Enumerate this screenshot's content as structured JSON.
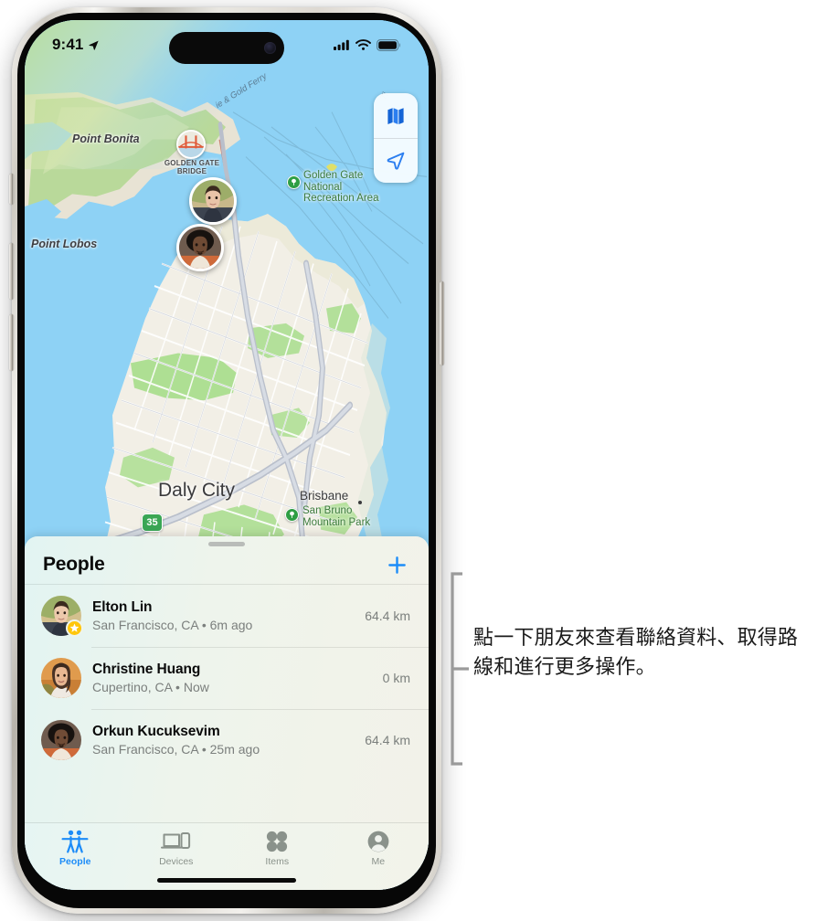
{
  "status_bar": {
    "time": "9:41",
    "location_icon": "location-arrow-icon",
    "cellular_icon": "cellular-signal-icon",
    "wifi_icon": "wifi-icon",
    "battery_icon": "battery-full-icon"
  },
  "map": {
    "controls": [
      {
        "name": "map-layers-button",
        "icon": "folded-map-icon"
      },
      {
        "name": "current-location-button",
        "icon": "navigation-arrow-icon"
      }
    ],
    "labels": [
      {
        "text": "Point Bonita",
        "style": "water"
      },
      {
        "text": "Point Lobos",
        "style": "water"
      },
      {
        "text": "GOLDEN GATE\nBRIDGE",
        "style": "poi"
      },
      {
        "text": "ie & Gold Ferry",
        "style": "water-small"
      },
      {
        "text": "Golden Gate\nNational\nRecreation Area",
        "style": "park"
      },
      {
        "text": "Daly City",
        "style": "city"
      },
      {
        "text": "Brisbane",
        "style": "town"
      },
      {
        "text": "San Bruno\nMountain Park",
        "style": "park"
      },
      {
        "text": "35",
        "style": "shield"
      }
    ],
    "avatars": [
      {
        "name": "map-avatar-elton-lin"
      },
      {
        "name": "map-avatar-orkun-kucuksevim"
      }
    ]
  },
  "sheet": {
    "title": "People",
    "add_button_label": "+",
    "people": [
      {
        "name": "Elton Lin",
        "subtitle": "San Francisco, CA • 6m ago",
        "distance": "64.4 km",
        "badge": "star-badge"
      },
      {
        "name": "Christine Huang",
        "subtitle": "Cupertino, CA • Now",
        "distance": "0 km",
        "badge": ""
      },
      {
        "name": "Orkun Kucuksevim",
        "subtitle": "San Francisco, CA • 25m ago",
        "distance": "64.4 km",
        "badge": ""
      }
    ]
  },
  "tab_bar": {
    "tabs": [
      {
        "label": "People",
        "icon": "two-people-icon",
        "active": true
      },
      {
        "label": "Devices",
        "icon": "laptop-phone-icon",
        "active": false
      },
      {
        "label": "Items",
        "icon": "four-dots-icon",
        "active": false
      },
      {
        "label": "Me",
        "icon": "person-circle-icon",
        "active": false
      }
    ]
  },
  "callout": {
    "text": "點一下朋友來查看聯絡資料、取得路線和進行更多操作。"
  },
  "colors": {
    "accent_blue": "#1c8cf8",
    "star_yellow": "#ffc60a",
    "water": "#8ed2f5",
    "land": "#f2efe6",
    "park_green": "#a8dd8c",
    "secondary_text": "#7b7f7d"
  }
}
